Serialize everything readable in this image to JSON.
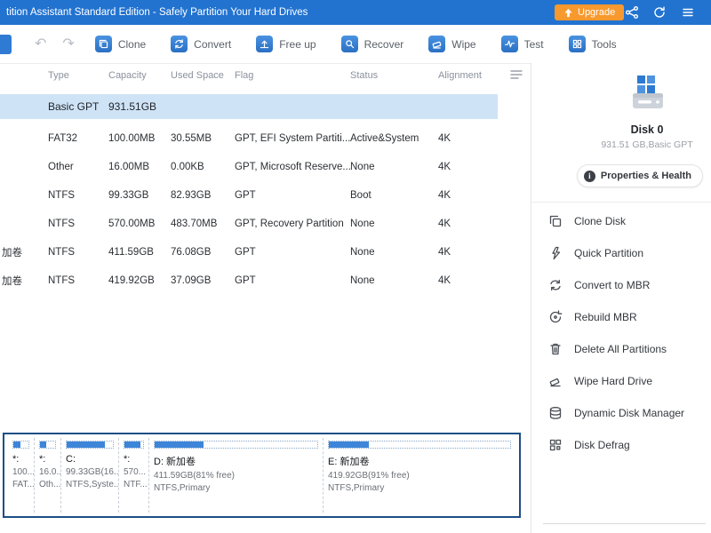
{
  "titlebar": {
    "title": "tition Assistant Standard Edition - Safely Partition Your Hard Drives",
    "upgrade_label": "Upgrade"
  },
  "icons": {
    "undo": "↶",
    "redo": "↷",
    "info": "i",
    "share": "share-nodes-icon",
    "refresh": "refresh-icon",
    "menu": "hamburger-menu-icon"
  },
  "toolbar": {
    "buttons": [
      "Clone",
      "Convert",
      "Free up",
      "Recover",
      "Wipe",
      "Test",
      "Tools"
    ]
  },
  "table": {
    "columns": [
      "Type",
      "Capacity",
      "Used Space",
      "Flag",
      "Status",
      "Alignment"
    ],
    "disk_row": {
      "type": "Basic GPT",
      "capacity": "931.51GB"
    },
    "rows": [
      {
        "name": "",
        "type": "FAT32",
        "capacity": "100.00MB",
        "used": "30.55MB",
        "flag": "GPT, EFI System Partiti...",
        "status": "Active&System",
        "alignment": "4K"
      },
      {
        "name": "",
        "type": "Other",
        "capacity": "16.00MB",
        "used": "0.00KB",
        "flag": "GPT, Microsoft Reserve...",
        "status": "None",
        "alignment": "4K"
      },
      {
        "name": "",
        "type": "NTFS",
        "capacity": "99.33GB",
        "used": "82.93GB",
        "flag": "GPT",
        "status": "Boot",
        "alignment": "4K"
      },
      {
        "name": "",
        "type": "NTFS",
        "capacity": "570.00MB",
        "used": "483.70MB",
        "flag": "GPT, Recovery Partition",
        "status": "None",
        "alignment": "4K"
      },
      {
        "name": "加卷",
        "type": "NTFS",
        "capacity": "411.59GB",
        "used": "76.08GB",
        "flag": "GPT",
        "status": "None",
        "alignment": "4K"
      },
      {
        "name": "加卷",
        "type": "NTFS",
        "capacity": "419.92GB",
        "used": "37.09GB",
        "flag": "GPT",
        "status": "None",
        "alignment": "4K"
      }
    ]
  },
  "diskmap": {
    "blocks": [
      {
        "label": "*:",
        "size": "100...",
        "fs": "FAT...",
        "fill": 45
      },
      {
        "label": "*:",
        "size": "16.0...",
        "fs": "Oth...",
        "fill": 40
      },
      {
        "label": "C:",
        "size": "99.33GB(16...",
        "fs": "NTFS,Syste...",
        "fill": 83
      },
      {
        "label": "*:",
        "size": "570...",
        "fs": "NTF...",
        "fill": 85
      },
      {
        "label": "D: 新加卷",
        "size": "411.59GB(81% free)",
        "fs": "NTFS,Primary",
        "fill": 30
      },
      {
        "label": "E: 新加卷",
        "size": "419.92GB(91% free)",
        "fs": "NTFS,Primary",
        "fill": 22
      }
    ]
  },
  "sidebar": {
    "disk_name": "Disk 0",
    "disk_info": "931.51 GB,Basic GPT",
    "properties_label": "Properties & Health",
    "actions": [
      "Clone Disk",
      "Quick Partition",
      "Convert to MBR",
      "Rebuild MBR",
      "Delete All Partitions",
      "Wipe Hard Drive",
      "Dynamic Disk Manager",
      "Disk Defrag"
    ]
  },
  "colors": {
    "titlebar_blue": "#2273d0",
    "accent_blue": "#2f7bd4",
    "upgrade_orange": "#f8992e",
    "row_highlight": "#cfe3f6",
    "diskmap_border": "#1d4e86",
    "bar_fill": "#3d85d9"
  }
}
